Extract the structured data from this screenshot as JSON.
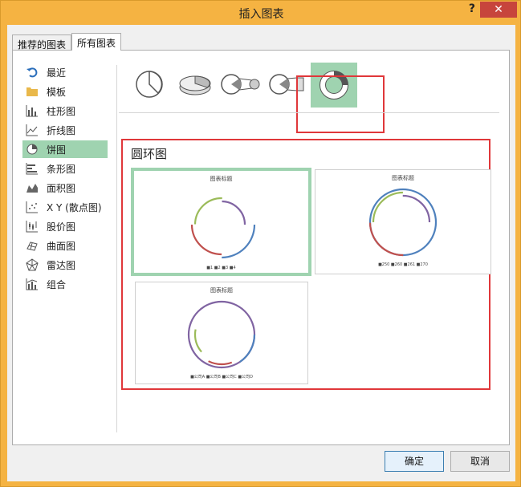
{
  "window": {
    "title": "插入图表",
    "help_label": "?",
    "close_label": "✕"
  },
  "tabs": [
    {
      "label": "推荐的图表"
    },
    {
      "label": "所有图表"
    }
  ],
  "categories": [
    {
      "label": "最近",
      "icon": "recent-icon"
    },
    {
      "label": "模板",
      "icon": "folder-icon"
    },
    {
      "label": "柱形图",
      "icon": "column-chart-icon"
    },
    {
      "label": "折线图",
      "icon": "line-chart-icon"
    },
    {
      "label": "饼图",
      "icon": "pie-chart-icon"
    },
    {
      "label": "条形图",
      "icon": "bar-chart-icon"
    },
    {
      "label": "面积图",
      "icon": "area-chart-icon"
    },
    {
      "label": "X Y (散点图)",
      "icon": "scatter-chart-icon"
    },
    {
      "label": "股价图",
      "icon": "stock-chart-icon"
    },
    {
      "label": "曲面图",
      "icon": "surface-chart-icon"
    },
    {
      "label": "雷达图",
      "icon": "radar-chart-icon"
    },
    {
      "label": "组合",
      "icon": "combo-chart-icon"
    }
  ],
  "selected_category": "饼图",
  "subtypes": [
    {
      "name": "pie"
    },
    {
      "name": "3d-pie"
    },
    {
      "name": "pie-of-pie"
    },
    {
      "name": "bar-of-pie"
    },
    {
      "name": "doughnut"
    }
  ],
  "section_title": "圆环图",
  "previews": [
    {
      "title": "图表标题",
      "legend": "■1  ■2  ■3  ■4"
    },
    {
      "title": "图表标题",
      "legend": "■250  ■260  ■261  ■270"
    },
    {
      "title": "图表标题",
      "legend": "■公司A  ■公司B  ■公司C  ■公司D"
    }
  ],
  "buttons": {
    "ok": "确定",
    "cancel": "取消"
  },
  "colors": {
    "accent_selected": "#9fd3b0",
    "highlight_red": "#e0373a",
    "blue": "#4f81bd",
    "red": "#c0504d",
    "green": "#9bbb59",
    "purple": "#8064a2"
  }
}
